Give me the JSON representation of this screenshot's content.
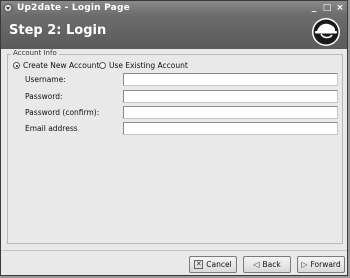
{
  "window": {
    "title": "Up2date - Login Page",
    "controls": {
      "minimize": "_",
      "maximize": "□",
      "close": "×"
    }
  },
  "header": {
    "title": "Step 2: Login"
  },
  "account_info": {
    "legend": "Account Info",
    "options": [
      {
        "label": "Create New Account",
        "selected": true
      },
      {
        "label": "Use Existing Account",
        "selected": false
      }
    ],
    "fields": [
      {
        "label": "Username:",
        "value": ""
      },
      {
        "label": "Password:",
        "value": ""
      },
      {
        "label": "Password (confirm):",
        "value": ""
      },
      {
        "label": "Email address",
        "value": ""
      }
    ]
  },
  "buttons": {
    "cancel": "Cancel",
    "back": "Back",
    "forward": "Forward"
  },
  "icons": {
    "window_menu": "window-menu-icon",
    "logo": "redhat-shadowman-icon",
    "cancel": "x-icon",
    "back": "arrow-left-icon",
    "forward": "arrow-right-icon"
  }
}
